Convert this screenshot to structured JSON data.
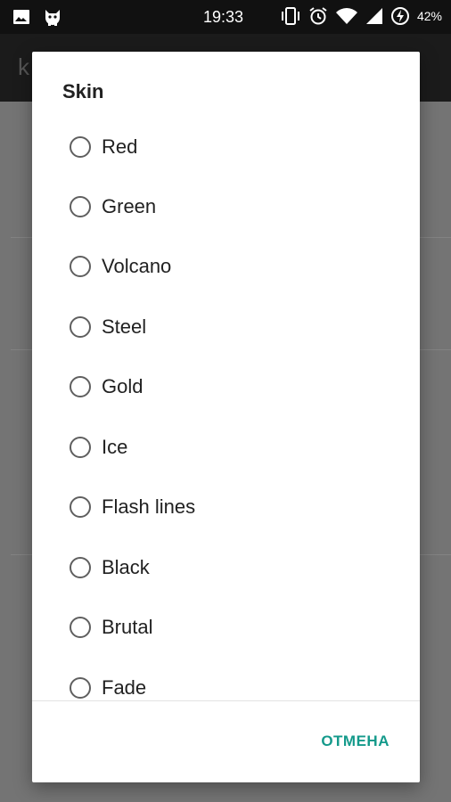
{
  "status_bar": {
    "time": "19:33",
    "battery": "42%",
    "left_icons": [
      "image-icon",
      "cat-icon"
    ],
    "right_icons": [
      "vibrate-icon",
      "alarm-icon",
      "wifi-icon",
      "signal-icon",
      "battery-charging-icon"
    ]
  },
  "app_bar": {
    "partial_title": "k"
  },
  "dialog": {
    "title": "Skin",
    "options": [
      {
        "label": "Red",
        "selected": false
      },
      {
        "label": "Green",
        "selected": false
      },
      {
        "label": "Volcano",
        "selected": false
      },
      {
        "label": "Steel",
        "selected": false
      },
      {
        "label": "Gold",
        "selected": false
      },
      {
        "label": "Ice",
        "selected": false
      },
      {
        "label": "Flash lines",
        "selected": false
      },
      {
        "label": "Black",
        "selected": false
      },
      {
        "label": "Brutal",
        "selected": false
      },
      {
        "label": "Fade",
        "selected": false
      }
    ],
    "cancel_label": "ОТМЕНА"
  },
  "colors": {
    "accent": "#149a8b",
    "status_bar": "#111111",
    "scrim": "#747474"
  }
}
